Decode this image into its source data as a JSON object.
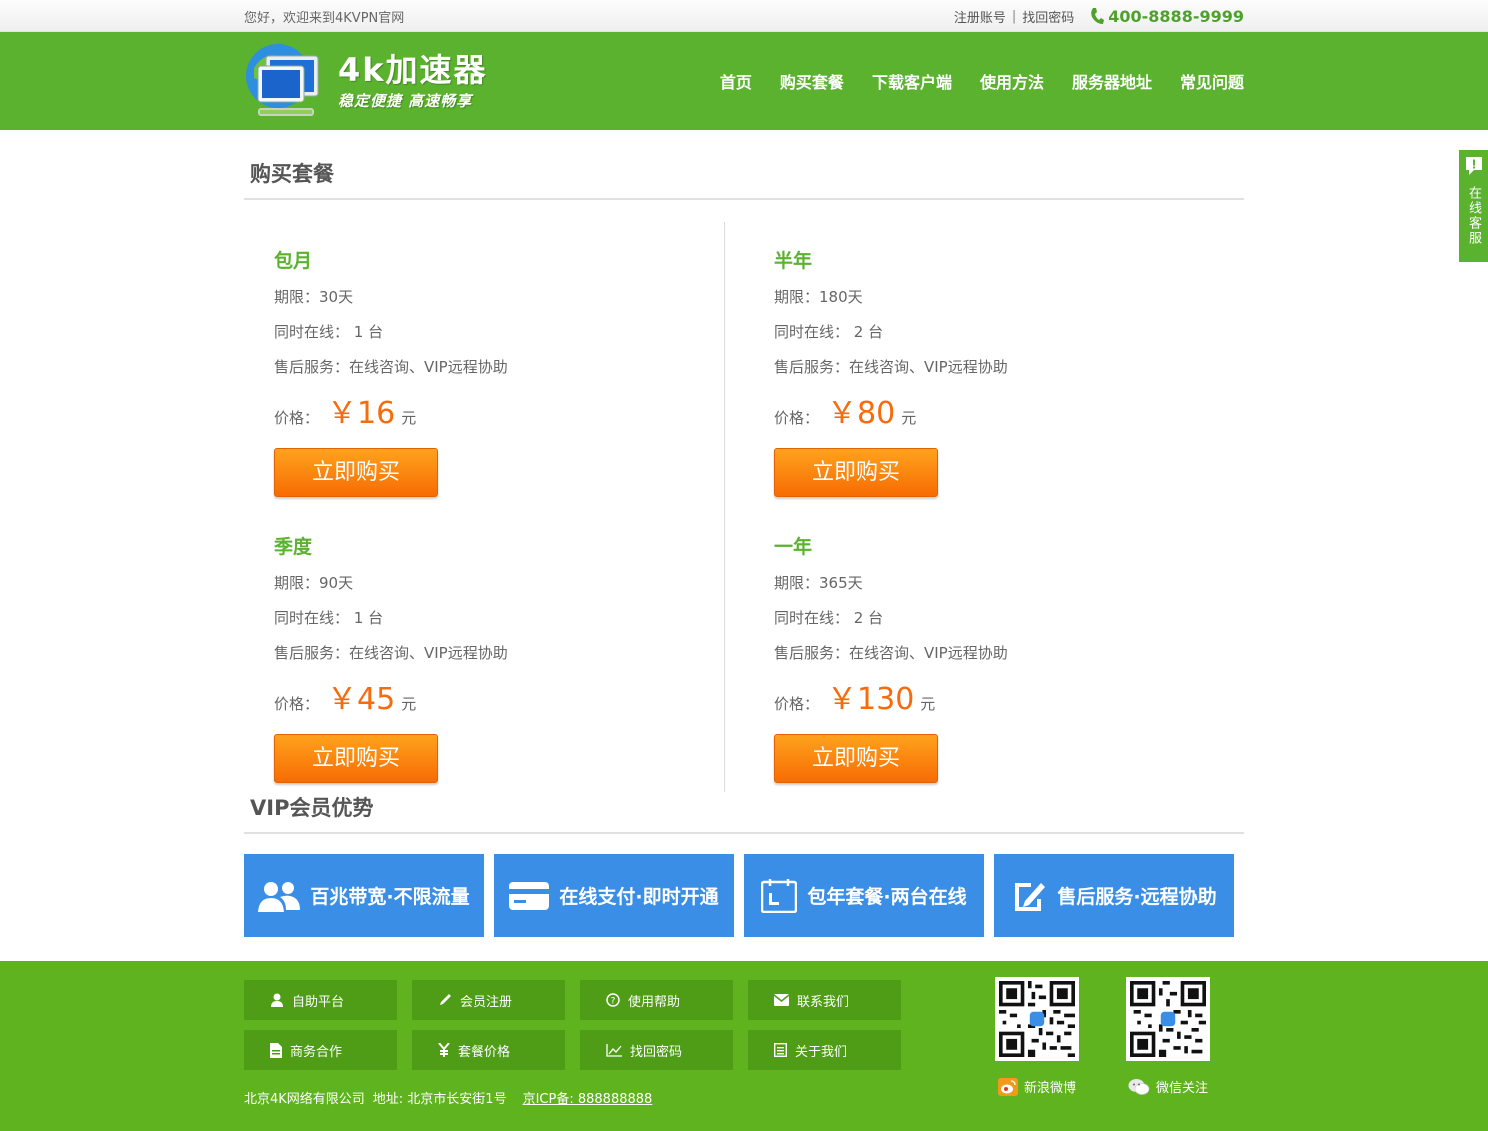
{
  "topbar": {
    "welcome": "您好，欢迎来到4KVPN官网",
    "register": "注册账号",
    "separator": "|",
    "recover": "找回密码",
    "phone": "400-8888-9999"
  },
  "header": {
    "logo_title": "4k加速器",
    "logo_sub": "稳定便捷 高速畅享",
    "nav": [
      "首页",
      "购买套餐",
      "下载客户端",
      "使用方法",
      "服务器地址",
      "常见问题"
    ]
  },
  "plans_section": {
    "title": "购买套餐",
    "plans": [
      {
        "name": "包月",
        "period": "期限：30天",
        "devices": "同时在线： 1 台",
        "service": "售后服务：在线咨询、VIP远程协助",
        "price_label": "价格：",
        "price": "￥16",
        "unit": "元",
        "button": "立即购买"
      },
      {
        "name": "半年",
        "period": "期限：180天",
        "devices": "同时在线： 2 台",
        "service": "售后服务：在线咨询、VIP远程协助",
        "price_label": "价格：",
        "price": "￥80",
        "unit": "元",
        "button": "立即购买"
      },
      {
        "name": "季度",
        "period": "期限：90天",
        "devices": "同时在线： 1 台",
        "service": "售后服务：在线咨询、VIP远程协助",
        "price_label": "价格：",
        "price": "￥45",
        "unit": "元",
        "button": "立即购买"
      },
      {
        "name": "一年",
        "period": "期限：365天",
        "devices": "同时在线： 2 台",
        "service": "售后服务：在线咨询、VIP远程协助",
        "price_label": "价格：",
        "price": "￥130",
        "unit": "元",
        "button": "立即购买"
      }
    ]
  },
  "vip_section": {
    "title": "VIP会员优势",
    "items": [
      {
        "label": "百兆带宽·不限流量",
        "icon": "users-icon"
      },
      {
        "label": "在线支付·即时开通",
        "icon": "card-icon"
      },
      {
        "label": "包年套餐·两台在线",
        "icon": "calendar-icon"
      },
      {
        "label": "售后服务·远程协助",
        "icon": "edit-icon"
      }
    ]
  },
  "footer": {
    "links": [
      {
        "label": "自助平台",
        "icon": "user-icon"
      },
      {
        "label": "会员注册",
        "icon": "pencil-icon"
      },
      {
        "label": "使用帮助",
        "icon": "help-icon"
      },
      {
        "label": "联系我们",
        "icon": "mail-icon"
      },
      {
        "label": "商务合作",
        "icon": "document-icon"
      },
      {
        "label": "套餐价格",
        "icon": "yen-icon"
      },
      {
        "label": "找回密码",
        "icon": "chart-icon"
      },
      {
        "label": "关于我们",
        "icon": "list-icon"
      }
    ],
    "company": "北京4K网络有限公司",
    "address": "地址: 北京市长安街1号",
    "icp": "京ICP备: 888888888",
    "weibo": "新浪微博",
    "wechat": "微信关注"
  },
  "side_tab": {
    "label": "在线客服"
  },
  "colors": {
    "brand_green": "#5bb22e",
    "price_orange": "#f76b0c",
    "vip_blue": "#3a8ee6"
  }
}
